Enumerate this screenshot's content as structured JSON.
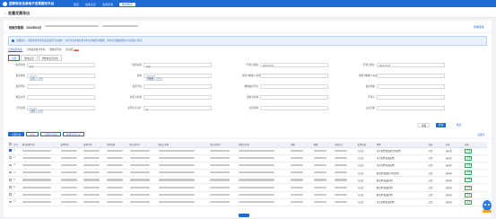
{
  "app": {
    "title": "国家税务总局电子发票服务平台",
    "nav": [
      "首页",
      "发票业务",
      "发票查询",
      "税务数字"
    ]
  },
  "page": {
    "back_label": "← 批量发票导出"
  },
  "info": {
    "label": "税款所属期：2024年04月",
    "right_link": "查看更多"
  },
  "alert": {
    "text": "温馨提示：请按查询条件筛选后进行导出操作，支持导出查询结果中的全部或选中数据，单次导出数据量较大时请耐心等待。"
  },
  "tabs": [
    {
      "label": "全部发票查询",
      "on": true
    },
    {
      "label": "全电发票统计查询"
    },
    {
      "label": "数电票查询"
    },
    {
      "label": "新功能",
      "badge": "NEW"
    }
  ],
  "subtabs": [
    {
      "label": "全部",
      "on": true
    },
    {
      "label": "数电发票"
    },
    {
      "label": "非数电发票查询"
    }
  ],
  "filters": {
    "r1": [
      {
        "label": "* 发票状态",
        "value": "正常"
      },
      {
        "label": "* 发票来源",
        "value": "全部"
      },
      {
        "label": "* 开票日期起",
        "value": "2024-03-01"
      },
      {
        "label": "* 开票日期止",
        "value": "2024-03-31"
      }
    ],
    "r2": [
      {
        "label": "发票状态",
        "tag": "正常",
        "more": "+4"
      },
      {
        "label": "票种",
        "tag": "增值税",
        "more": "+3"
      },
      {
        "label": "购买方纳税人识别号",
        "value": ""
      },
      {
        "label": "销售方纳税人识别号",
        "value": ""
      }
    ],
    "r3": [
      {
        "label": "发票代码",
        "value": ""
      },
      {
        "label": "发票号码",
        "value": ""
      },
      {
        "label": "数电发票号码",
        "value": ""
      },
      {
        "label": "发票金额",
        "value": ""
      }
    ],
    "r4": [
      {
        "label": "特定业务",
        "value": ""
      },
      {
        "label": "购买方名称",
        "value": ""
      },
      {
        "label": "销售方名称",
        "value": ""
      },
      {
        "label": "开票人",
        "value": ""
      }
    ],
    "r5": [
      {
        "label": "上传日期",
        "tag": "全部",
        "more": "+3"
      },
      {
        "label": "是否为不动产",
        "value": "否"
      },
      {
        "label": "标签名称",
        "value": ""
      },
      {
        "label": "认证日期",
        "value": ""
      }
    ]
  },
  "buttons": {
    "reset": "重置",
    "search": "查询",
    "expand": "收起"
  },
  "toolbar": {
    "export_all": "全部导出",
    "export_sel": "导出",
    "export_list": "下载导出列表",
    "export_tpl": "批量导出记录",
    "settings": "设置列"
  },
  "table": {
    "headers": [
      "",
      "序号",
      "数电发票号码",
      "发票代码",
      "发票号码",
      "开票日期",
      "购方识别号",
      "购买方名称",
      "销方识别号",
      "销售方名称",
      "金额",
      "税额",
      "价税合计",
      "发票来源",
      "票种",
      "状态",
      "标签",
      "操作"
    ],
    "rows": [
      {
        "no": "1",
        "source": "已认证",
        "type": "电子发票(增值税专用发票)",
        "status": "正常",
        "flag": "未标签",
        "op": "详情"
      },
      {
        "no": "2",
        "source": "已认证",
        "type": "电子发票(普通发票)",
        "status": "正常",
        "flag": "未标签",
        "op": "详情"
      },
      {
        "no": "3",
        "source": "已认证",
        "type": "电子发票(普通发票)",
        "status": "正常",
        "flag": "未标签",
        "op": "详情"
      },
      {
        "no": "4",
        "source": "已认证",
        "type": "数电票(增值税专用发票)",
        "status": "正常",
        "flag": "未标签",
        "op": "详情"
      },
      {
        "no": "5",
        "source": "已认证",
        "type": "数电票(普通发票)",
        "status": "正常",
        "flag": "未标签",
        "op": "详情"
      },
      {
        "no": "6",
        "source": "已认证",
        "type": "数电票(普通发票)",
        "status": "正常",
        "flag": "未标签",
        "op": "详情"
      },
      {
        "no": "7",
        "source": "已认证",
        "type": "数电票(普通发票)",
        "status": "正常",
        "flag": "未标签",
        "op": "详情"
      },
      {
        "no": "8",
        "source": "已认证",
        "type": "电子发票(普通发票)",
        "status": "正常",
        "flag": "未标签",
        "op": "详情"
      }
    ]
  }
}
